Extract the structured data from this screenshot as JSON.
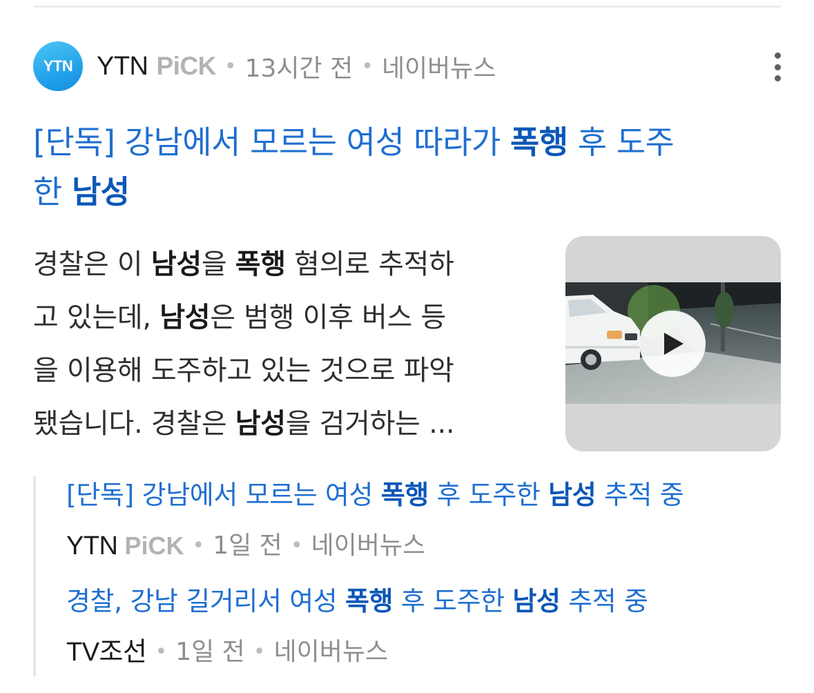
{
  "article": {
    "logo_text": "YTN",
    "press": "YTN",
    "pick_badge": "PiCK",
    "time": "13시간 전",
    "platform": "네이버뉴스",
    "headline": {
      "seg1": "[단독] 강남에서 모르는 여성 따라가 ",
      "kw1": "폭행",
      "seg2": " 후 도주",
      "seg3": "한 ",
      "kw2": "남성"
    },
    "snippet": {
      "s1": "경찰은 이 ",
      "k1": "남성",
      "s2": "을 ",
      "k2": "폭행",
      "s3": " 혐의로 추적하",
      "s4": "고 있는데, ",
      "k3": "남성",
      "s5": "은 범행 이후 버스 등",
      "s6": "을 이용해 도주하고 있는 것으로 파악",
      "s7": "됐습니다. 경찰은 ",
      "k4": "남성",
      "s8": "을 검거하는 ..."
    },
    "thumbnail_icon": "play-icon"
  },
  "related": [
    {
      "title": {
        "a": "[단독] 강남에서 모르는 여성 ",
        "k1": "폭행",
        "b": " 후 도주한 ",
        "k2": "남성",
        "c": " 추적 중"
      },
      "press": "YTN",
      "pick_badge": "PiCK",
      "time": "1일 전",
      "platform": "네이버뉴스"
    },
    {
      "title": {
        "a": "경찰, 강남 길거리서 여성 ",
        "k1": "폭행",
        "b": " 후 도주한 ",
        "k2": "남성",
        "c": " 추적 중"
      },
      "press": "TV조선",
      "time": "1일 전",
      "platform": "네이버뉴스"
    }
  ],
  "colors": {
    "link": "#1f6fd1",
    "keyword": "#0c57b7",
    "meta": "#8e8e8e",
    "logo": "#1e9de8"
  }
}
